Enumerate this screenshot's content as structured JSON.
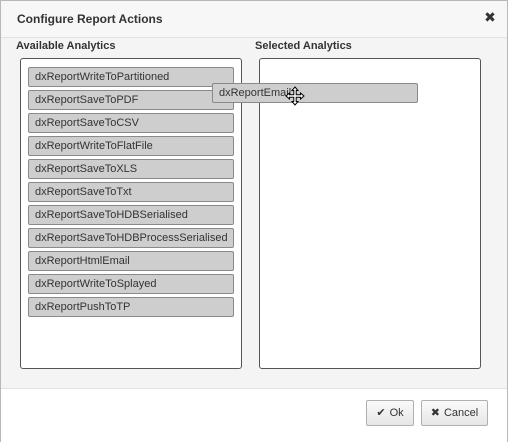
{
  "dialog": {
    "title": "Configure Report Actions",
    "close_icon": "close-icon"
  },
  "available": {
    "label": "Available Analytics",
    "items": [
      "dxReportWriteToPartitioned",
      "dxReportSaveToPDF",
      "dxReportSaveToCSV",
      "dxReportWriteToFlatFile",
      "dxReportSaveToXLS",
      "dxReportSaveToTxt",
      "dxReportSaveToHDBSerialised",
      "dxReportSaveToHDBProcessSerialised",
      "dxReportHtmlEmail",
      "dxReportWriteToSplayed",
      "dxReportPushToTP"
    ]
  },
  "selected": {
    "label": "Selected Analytics"
  },
  "dragging": {
    "label": "dxReportEmail",
    "cursor_icon": "move-cursor-icon"
  },
  "buttons": {
    "ok_label": "Ok",
    "ok_icon": "check-icon",
    "cancel_label": "Cancel",
    "cancel_icon": "close-icon"
  },
  "colors": {
    "item_bg": "#cecece",
    "item_border": "#8a8a8a",
    "panel_border": "#555555"
  }
}
